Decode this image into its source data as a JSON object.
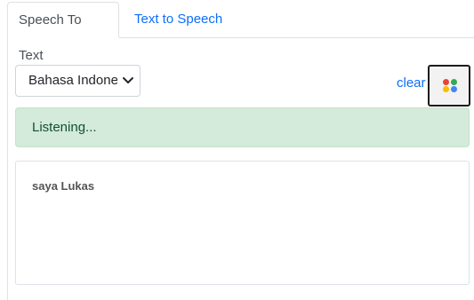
{
  "tabs": [
    {
      "label": "Speech To Text",
      "active": true
    },
    {
      "label": "Text to Speech",
      "active": false
    }
  ],
  "language_select": {
    "selected": "Bahasa Indonesia"
  },
  "toolbar": {
    "clear_label": "clear",
    "mic_icon": "google-mic-dots-icon",
    "dot_colors": [
      "#ea4335",
      "#34a853",
      "#fbbc05",
      "#4285f4"
    ]
  },
  "status": {
    "text": "Listening..."
  },
  "transcript": {
    "text": "saya Lukas"
  },
  "colors": {
    "link": "#0d6efd",
    "alert_bg": "#d4eadb",
    "alert_text": "#0f5132"
  }
}
